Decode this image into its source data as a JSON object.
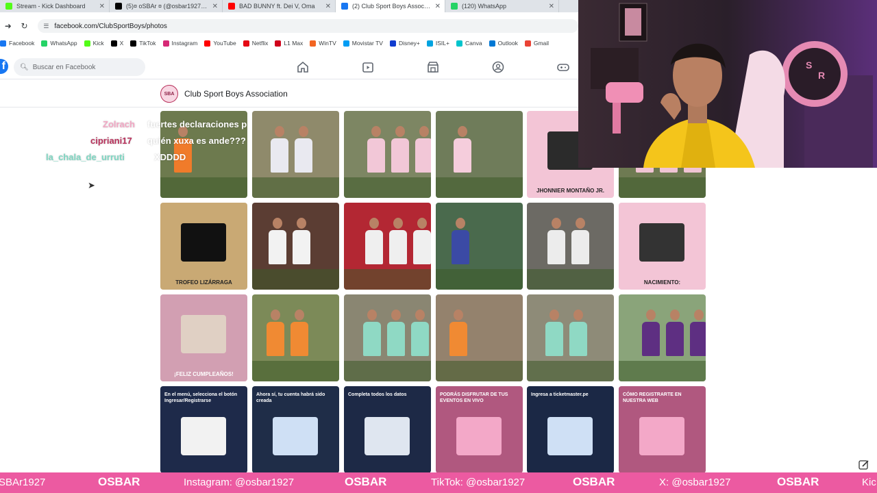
{
  "browser": {
    "tabs": [
      {
        "title": "Stream - Kick Dashboard",
        "color": "#53fc18"
      },
      {
        "title": "(5)¤ oSBAr ¤ (@osbar1927) | T",
        "color": "#000000"
      },
      {
        "title": "BAD BUNNY ft. Dei V, Oma",
        "color": "#ff0000"
      },
      {
        "title": "(2) Club Sport Boys Association",
        "color": "#1877f2"
      },
      {
        "title": "(120) WhatsApp",
        "color": "#25d366"
      }
    ],
    "url": "facebook.com/ClubSportBoys/photos",
    "bookmarks": [
      {
        "label": "Facebook",
        "color": "#1877f2"
      },
      {
        "label": "WhatsApp",
        "color": "#25d366"
      },
      {
        "label": "Kick",
        "color": "#53fc18"
      },
      {
        "label": "X",
        "color": "#000000"
      },
      {
        "label": "TikTok",
        "color": "#000000"
      },
      {
        "label": "Instagram",
        "color": "#d62976"
      },
      {
        "label": "YouTube",
        "color": "#ff0000"
      },
      {
        "label": "Netflix",
        "color": "#e50914"
      },
      {
        "label": "L1 Max",
        "color": "#d0021b"
      },
      {
        "label": "WinTV",
        "color": "#f26522"
      },
      {
        "label": "Movistar TV",
        "color": "#019df4"
      },
      {
        "label": "Disney+",
        "color": "#113ccf"
      },
      {
        "label": "ISIL+",
        "color": "#00a3e0"
      },
      {
        "label": "Canva",
        "color": "#00c4cc"
      },
      {
        "label": "Outlook",
        "color": "#0078d4"
      },
      {
        "label": "Gmail",
        "color": "#ea4335"
      }
    ]
  },
  "facebook": {
    "search_placeholder": "Buscar en Facebook",
    "page_title": "Club Sport Boys Association",
    "logo_text": "SBA"
  },
  "photos": [
    {
      "bg": "#6d7a4e",
      "accent": "#f07b2a",
      "caption": ""
    },
    {
      "bg": "#8f8a6b",
      "accent": "#e9e9f0",
      "caption": ""
    },
    {
      "bg": "#7d8663",
      "accent": "#f2c7d7",
      "caption": ""
    },
    {
      "bg": "#6f7c5a",
      "accent": "#f5cddc",
      "caption": ""
    },
    {
      "bg": "#f3c5d6",
      "accent": "#2b2b2b",
      "caption": "JHONNIER MONTAÑO JR."
    },
    {
      "bg": "#6e7a52",
      "accent": "#f0c4d4",
      "caption": ""
    },
    {
      "bg": "#c9a974",
      "accent": "#111111",
      "caption": "TROFEO LIZÁRRAGA"
    },
    {
      "bg": "#5b3d33",
      "accent": "#f2f2f2",
      "caption": ""
    },
    {
      "bg": "#b32733",
      "accent": "#efefef",
      "caption": ""
    },
    {
      "bg": "#4a6a4d",
      "accent": "#3b4aa5",
      "caption": ""
    },
    {
      "bg": "#6c6a64",
      "accent": "#ececec",
      "caption": ""
    },
    {
      "bg": "#f3c5d6",
      "accent": "#333333",
      "caption": "NACIMIENTO:"
    },
    {
      "bg": "#d29fb2",
      "accent": "#e0d0c4",
      "caption": "¡FELIZ CUMPLEAÑOS!"
    },
    {
      "bg": "#7c8a58",
      "accent": "#f08a33",
      "caption": ""
    },
    {
      "bg": "#8a8672",
      "accent": "#8fd9c4",
      "caption": ""
    },
    {
      "bg": "#94826d",
      "accent": "#f08a33",
      "caption": ""
    },
    {
      "bg": "#8e8b78",
      "accent": "#8fd9c4",
      "caption": ""
    },
    {
      "bg": "#8aa47a",
      "accent": "#5e2f82",
      "caption": ""
    },
    {
      "bg": "#1e2a4a",
      "accent": "#f2f2f2",
      "caption": "En el menú, selecciona el botón Ingresar/Registrarse"
    },
    {
      "bg": "#1f2d48",
      "accent": "#cfe0f5",
      "caption": "Ahora sí, tu cuenta habrá sido creada"
    },
    {
      "bg": "#1d2946",
      "accent": "#dfe6f0",
      "caption": "Completa todos los datos"
    },
    {
      "bg": "#b0587f",
      "accent": "#f3a8c8",
      "caption": "PODRÁS DISFRUTAR DE TUS EVENTOS EN VIVO"
    },
    {
      "bg": "#1b2845",
      "accent": "#cfe0f5",
      "caption": "Ingresa a ticketmaster.pe"
    },
    {
      "bg": "#b0587f",
      "accent": "#f3a8c8",
      "caption": "CÓMO REGISTRARTE EN NUESTRA WEB"
    }
  ],
  "chat": [
    {
      "user": "Zolrach",
      "user_color": "#f2a7c4",
      "message": "fuertes declaraciones p",
      "msg_color": "#ffffff"
    },
    {
      "user": "cipriani17",
      "user_color": "#b8325c",
      "message": "quién xuxa es ande???",
      "msg_color": "#ffffff"
    },
    {
      "user": "la_chala_de_urruti",
      "user_color": "#7fd6c2",
      "message": "XDDDD",
      "msg_color": "#ffffff"
    }
  ],
  "ticker": {
    "items": [
      "SBAr1927",
      "OSBAR",
      "Instagram: @osbar1927",
      "OSBAR",
      "TikTok: @osbar1927",
      "OSBAR",
      "X: @osbar1927",
      "OSBAR",
      "Kic"
    ],
    "bg": "#ec5aa1"
  }
}
